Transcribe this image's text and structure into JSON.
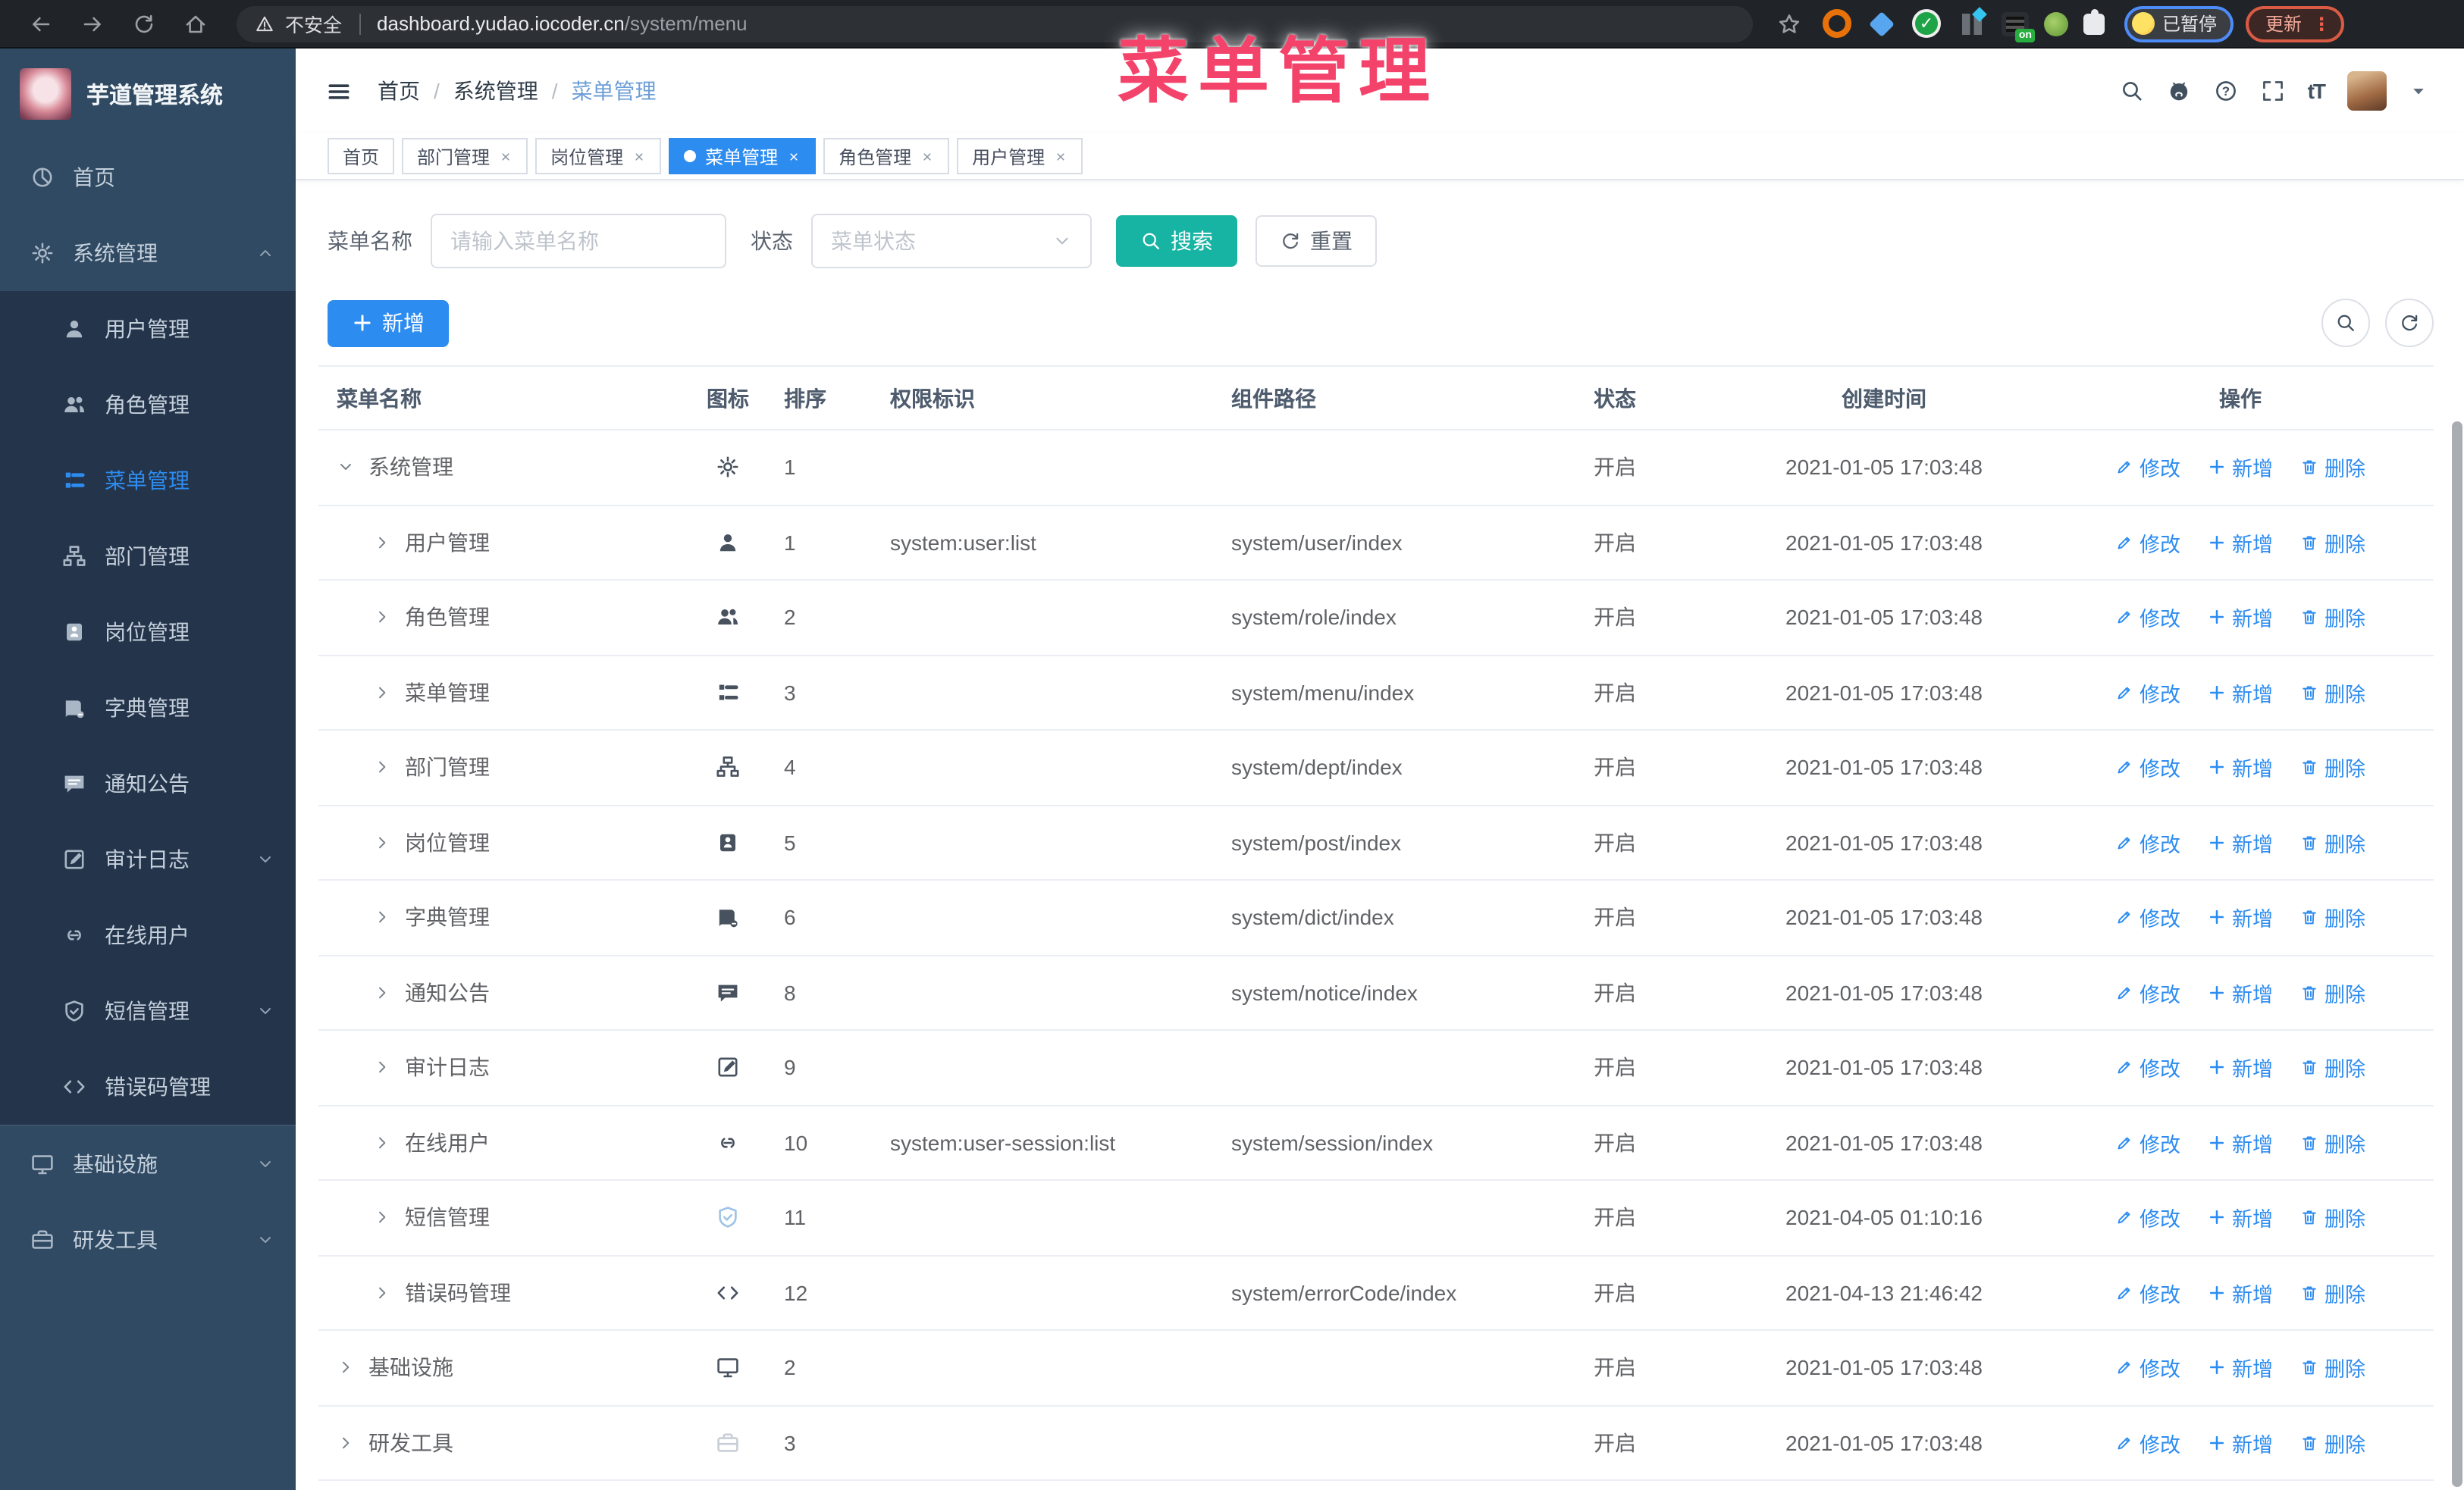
{
  "browser": {
    "not_secure": "不安全",
    "url_host": "dashboard.yudao.iocoder.cn",
    "url_path": "/system/menu",
    "paused_label": "已暂停",
    "update_label": "更新",
    "update_dots": "⋮",
    "on_badge": "on"
  },
  "watermark": "菜单管理",
  "sidebar": {
    "title": "芋道管理系统",
    "items": [
      {
        "label": "首页",
        "icon": "dashboard",
        "level": 0
      },
      {
        "label": "系统管理",
        "icon": "gear",
        "level": 0,
        "chevron": "up"
      },
      {
        "label": "用户管理",
        "icon": "user",
        "level": 1
      },
      {
        "label": "角色管理",
        "icon": "users",
        "level": 1
      },
      {
        "label": "菜单管理",
        "icon": "menu-list",
        "level": 1,
        "active": true
      },
      {
        "label": "部门管理",
        "icon": "tree",
        "level": 1
      },
      {
        "label": "岗位管理",
        "icon": "badge",
        "level": 1
      },
      {
        "label": "字典管理",
        "icon": "book",
        "level": 1
      },
      {
        "label": "通知公告",
        "icon": "message",
        "level": 1
      },
      {
        "label": "审计日志",
        "icon": "form",
        "level": 1,
        "chevron": "down"
      },
      {
        "label": "在线用户",
        "icon": "link",
        "level": 1
      },
      {
        "label": "短信管理",
        "icon": "shield",
        "level": 1,
        "chevron": "down"
      },
      {
        "label": "错误码管理",
        "icon": "code",
        "level": 1
      },
      {
        "label": "基础设施",
        "icon": "monitor",
        "level": 0,
        "chevron": "down",
        "sep": true
      },
      {
        "label": "研发工具",
        "icon": "toolbox",
        "level": 0,
        "chevron": "down"
      }
    ]
  },
  "header": {
    "breadcrumb": [
      "首页",
      "系统管理",
      "菜单管理"
    ],
    "font_size_glyph": "tT"
  },
  "tabs": [
    {
      "label": "首页",
      "closable": false,
      "active": false
    },
    {
      "label": "部门管理",
      "closable": true,
      "active": false
    },
    {
      "label": "岗位管理",
      "closable": true,
      "active": false
    },
    {
      "label": "菜单管理",
      "closable": true,
      "active": true
    },
    {
      "label": "角色管理",
      "closable": true,
      "active": false
    },
    {
      "label": "用户管理",
      "closable": true,
      "active": false
    }
  ],
  "filters": {
    "name_label": "菜单名称",
    "name_placeholder": "请输入菜单名称",
    "status_label": "状态",
    "status_placeholder": "菜单状态",
    "search_label": "搜索",
    "reset_label": "重置"
  },
  "toolbar": {
    "add_label": "新增"
  },
  "table": {
    "columns": [
      "菜单名称",
      "图标",
      "排序",
      "权限标识",
      "组件路径",
      "状态",
      "创建时间",
      "操作"
    ],
    "action_labels": [
      "修改",
      "新增",
      "删除"
    ],
    "rows": [
      {
        "name": "系统管理",
        "level": 0,
        "arrow": "down",
        "icon": "gear",
        "tone": "dark",
        "order": "1",
        "perm": "",
        "path": "",
        "status": "开启",
        "time": "2021-01-05 17:03:48"
      },
      {
        "name": "用户管理",
        "level": 1,
        "arrow": "right",
        "icon": "user",
        "tone": "dark",
        "order": "1",
        "perm": "system:user:list",
        "path": "system/user/index",
        "status": "开启",
        "time": "2021-01-05 17:03:48"
      },
      {
        "name": "角色管理",
        "level": 1,
        "arrow": "right",
        "icon": "users",
        "tone": "dark",
        "order": "2",
        "perm": "",
        "path": "system/role/index",
        "status": "开启",
        "time": "2021-01-05 17:03:48"
      },
      {
        "name": "菜单管理",
        "level": 1,
        "arrow": "right",
        "icon": "menu-list",
        "tone": "dark",
        "order": "3",
        "perm": "",
        "path": "system/menu/index",
        "status": "开启",
        "time": "2021-01-05 17:03:48"
      },
      {
        "name": "部门管理",
        "level": 1,
        "arrow": "right",
        "icon": "tree",
        "tone": "dark",
        "order": "4",
        "perm": "",
        "path": "system/dept/index",
        "status": "开启",
        "time": "2021-01-05 17:03:48"
      },
      {
        "name": "岗位管理",
        "level": 1,
        "arrow": "right",
        "icon": "badge",
        "tone": "dark",
        "order": "5",
        "perm": "",
        "path": "system/post/index",
        "status": "开启",
        "time": "2021-01-05 17:03:48"
      },
      {
        "name": "字典管理",
        "level": 1,
        "arrow": "right",
        "icon": "book",
        "tone": "dark",
        "order": "6",
        "perm": "",
        "path": "system/dict/index",
        "status": "开启",
        "time": "2021-01-05 17:03:48"
      },
      {
        "name": "通知公告",
        "level": 1,
        "arrow": "right",
        "icon": "message",
        "tone": "dark",
        "order": "8",
        "perm": "",
        "path": "system/notice/index",
        "status": "开启",
        "time": "2021-01-05 17:03:48"
      },
      {
        "name": "审计日志",
        "level": 1,
        "arrow": "right",
        "icon": "form",
        "tone": "dark",
        "order": "9",
        "perm": "",
        "path": "",
        "status": "开启",
        "time": "2021-01-05 17:03:48"
      },
      {
        "name": "在线用户",
        "level": 1,
        "arrow": "right",
        "icon": "link",
        "tone": "dark",
        "order": "10",
        "perm": "system:user-session:list",
        "path": "system/session/index",
        "status": "开启",
        "time": "2021-01-05 17:03:48"
      },
      {
        "name": "短信管理",
        "level": 1,
        "arrow": "right",
        "icon": "shield",
        "tone": "light-blue",
        "order": "11",
        "perm": "",
        "path": "",
        "status": "开启",
        "time": "2021-04-05 01:10:16"
      },
      {
        "name": "错误码管理",
        "level": 1,
        "arrow": "right",
        "icon": "code",
        "tone": "dark",
        "order": "12",
        "perm": "",
        "path": "system/errorCode/index",
        "status": "开启",
        "time": "2021-04-13 21:46:42"
      },
      {
        "name": "基础设施",
        "level": 0,
        "arrow": "right",
        "icon": "monitor",
        "tone": "dark",
        "order": "2",
        "perm": "",
        "path": "",
        "status": "开启",
        "time": "2021-01-05 17:03:48"
      },
      {
        "name": "研发工具",
        "level": 0,
        "arrow": "right",
        "icon": "toolbox",
        "tone": "light-gray",
        "order": "3",
        "perm": "",
        "path": "",
        "status": "开启",
        "time": "2021-01-05 17:03:48"
      }
    ]
  }
}
